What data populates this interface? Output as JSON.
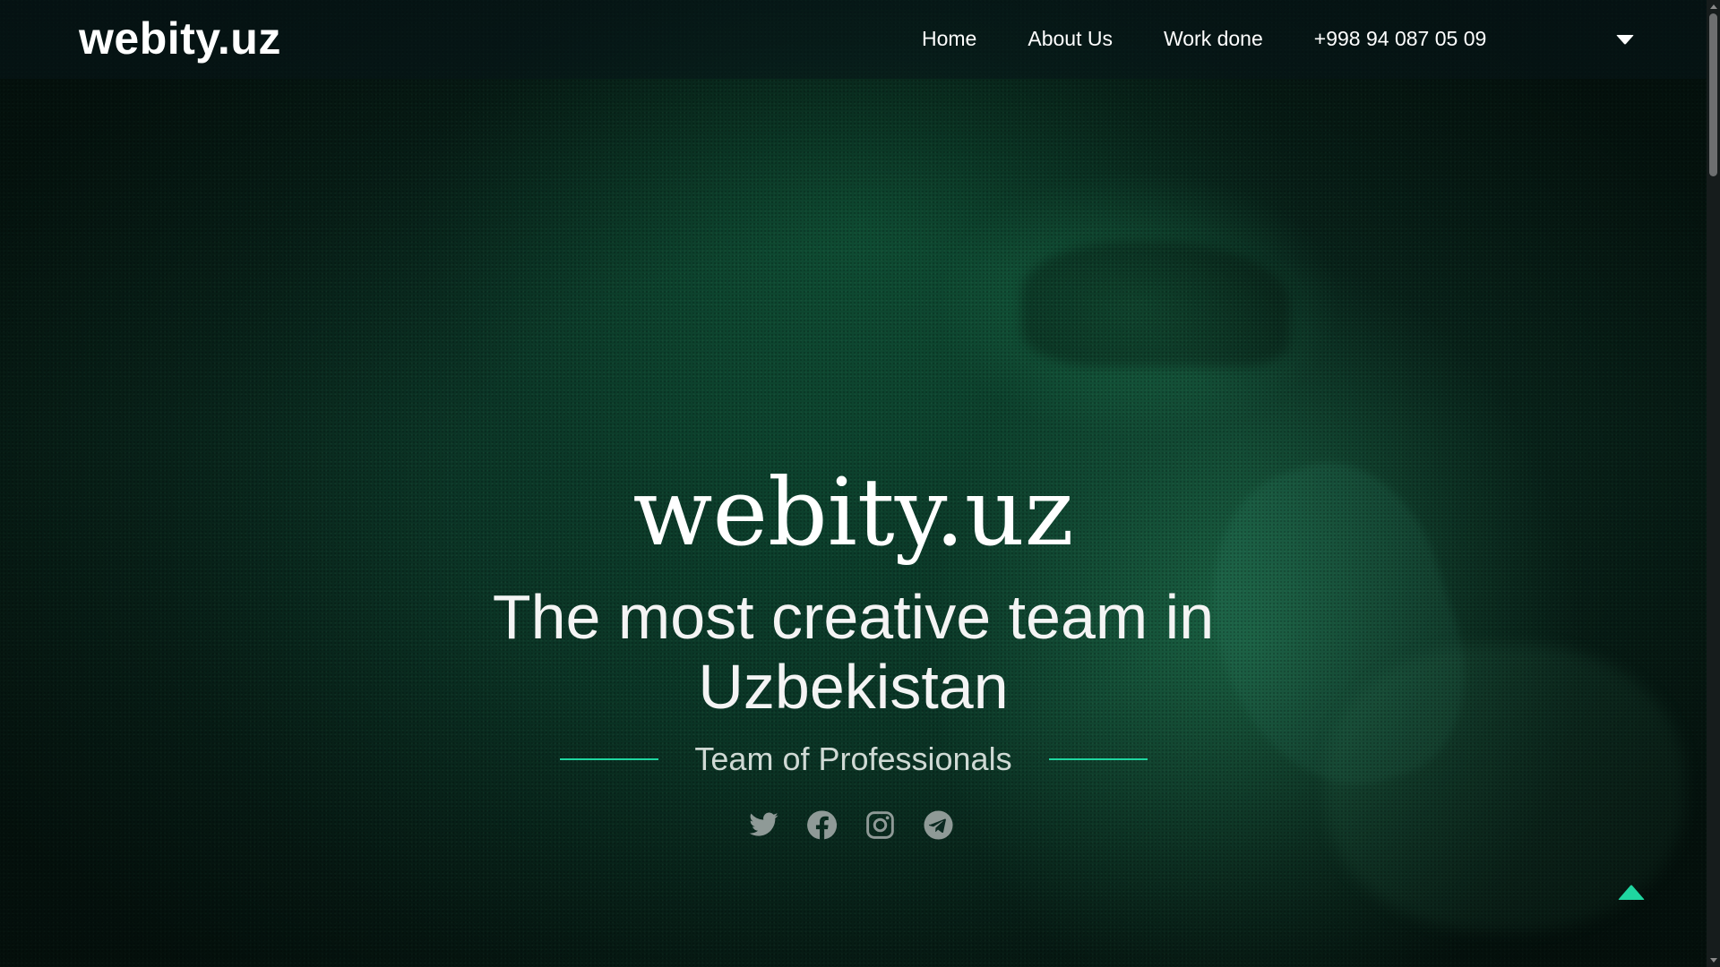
{
  "navbar": {
    "logo": "webity.uz",
    "links": [
      {
        "label": "Home"
      },
      {
        "label": "About Us"
      },
      {
        "label": "Work done"
      },
      {
        "label": "+998 94 087 05 09"
      }
    ],
    "dropdown_icon": "caret-down-icon"
  },
  "hero": {
    "title": "webity.uz",
    "subtitle": "The most creative team in Uzbekistan",
    "tagline": "Team of Professionals",
    "accent_color": "#1fd6a0",
    "socials": [
      {
        "icon": "twitter-icon"
      },
      {
        "icon": "facebook-icon"
      },
      {
        "icon": "instagram-icon"
      },
      {
        "icon": "telegram-icon"
      }
    ]
  },
  "back_to_top": {
    "icon": "caret-up-icon",
    "color": "#1fd6a0"
  }
}
